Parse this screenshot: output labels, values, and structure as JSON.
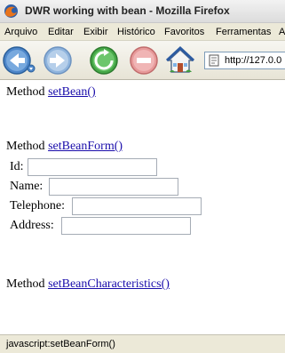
{
  "window": {
    "title": "DWR working with bean - Mozilla Firefox"
  },
  "menubar": {
    "items": [
      "Arquivo",
      "Editar",
      "Exibir",
      "Histórico",
      "Favoritos",
      "Ferramentas",
      "A"
    ]
  },
  "toolbar": {
    "address_value": "http://127.0.0",
    "icons": [
      "back-icon",
      "forward-icon",
      "reload-icon",
      "stop-icon",
      "home-icon",
      "page-icon"
    ]
  },
  "page": {
    "methods": [
      {
        "prefix": "Method",
        "link": "setBean()"
      },
      {
        "prefix": "Method",
        "link": "setBeanForm()"
      },
      {
        "prefix": "Method",
        "link": "setBeanCharacteristics()"
      }
    ],
    "form": {
      "fields": [
        {
          "label": "Id:",
          "value": ""
        },
        {
          "label": "Name:",
          "value": ""
        },
        {
          "label": "Telephone:",
          "value": ""
        },
        {
          "label": "Address:",
          "value": ""
        }
      ]
    }
  },
  "statusbar": {
    "text": "javascript:setBeanForm()"
  },
  "colors": {
    "link": "#1a0dab",
    "chrome": "#ece9d8"
  }
}
